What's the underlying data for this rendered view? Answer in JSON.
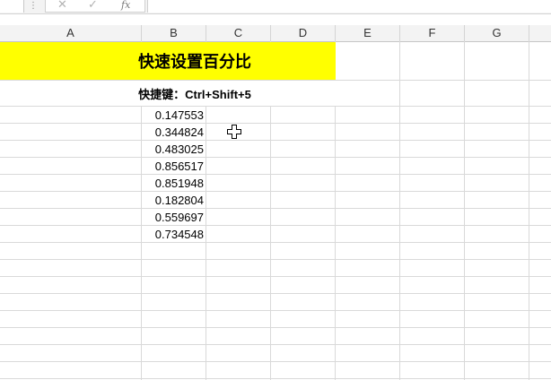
{
  "formula_bar": {
    "dots_icon": "vertical-ellipsis-icon",
    "cancel_icon": "cross-icon",
    "confirm_icon": "check-icon",
    "fx_label": "fx",
    "formula_value": ""
  },
  "columns": [
    "A",
    "B",
    "C",
    "D",
    "E",
    "F",
    "G"
  ],
  "sheet": {
    "title": "快速设置百分比",
    "title_bg": "#ffff00",
    "shortcut_text": "快捷键：Ctrl+Shift+5",
    "values": [
      "0.147553",
      "0.344824",
      "0.483025",
      "0.856517",
      "0.851948",
      "0.182804",
      "0.559697",
      "0.734548"
    ]
  }
}
